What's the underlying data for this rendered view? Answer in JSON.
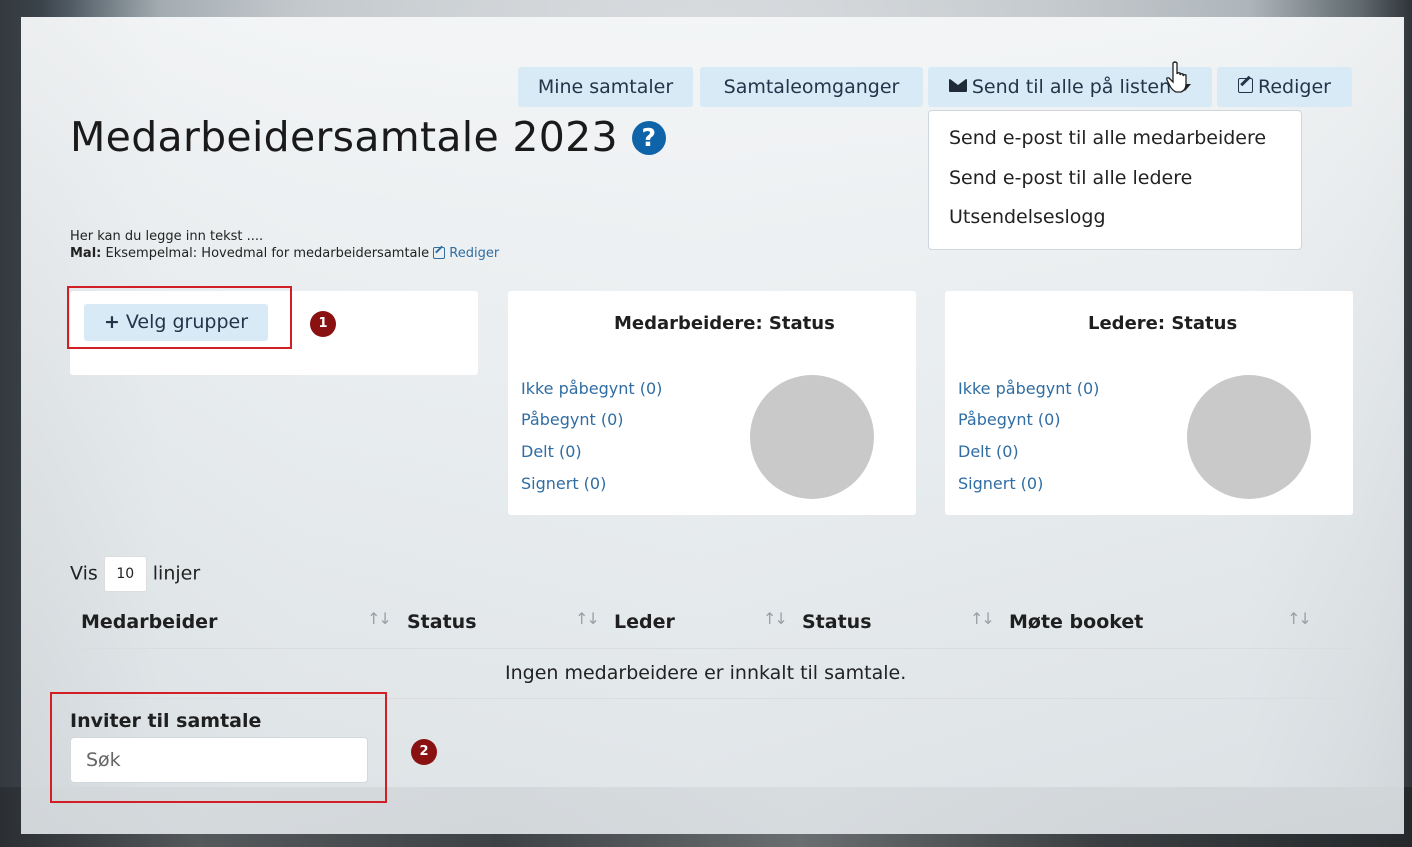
{
  "toolbar": {
    "mine_samtaler": "Mine samtaler",
    "samtaleomganger": "Samtaleomganger",
    "send_til_alle": "Send til alle på listen",
    "rediger": "Rediger"
  },
  "dropdown": {
    "items": [
      "Send e-post til alle medarbeidere",
      "Send e-post til alle ledere",
      "Utsendelseslogg"
    ]
  },
  "page": {
    "title": "Medarbeidersamtale 2023",
    "help": "?",
    "intro_text": "Her kan du legge inn tekst ....",
    "mal_label": "Mal:",
    "mal_value": "Eksempelmal: Hovedmal for medarbeidersamtale",
    "mal_edit": "Rediger"
  },
  "groups": {
    "velg_grupper": "Velg grupper",
    "plus": "+",
    "marker": "1"
  },
  "medarbeidere_status": {
    "title": "Medarbeidere: Status",
    "items": [
      "Ikke påbegynt (0)",
      "Påbegynt (0)",
      "Delt (0)",
      "Signert (0)"
    ]
  },
  "ledere_status": {
    "title": "Ledere: Status",
    "items": [
      "Ikke påbegynt (0)",
      "Påbegynt (0)",
      "Delt (0)",
      "Signert (0)"
    ]
  },
  "table": {
    "vis": "Vis",
    "page_size": "10",
    "linjer": "linjer",
    "columns": [
      "Medarbeider",
      "Status",
      "Leder",
      "Status",
      "Møte booket"
    ],
    "sort_glyph": "↑↓",
    "empty_message": "Ingen medarbeidere er innkalt til samtale."
  },
  "invite": {
    "label": "Inviter til samtale",
    "placeholder": "Søk",
    "marker": "2"
  },
  "colors": {
    "button_bg": "#d7eaf5",
    "link": "#2f6da3",
    "highlight_border": "#d21f26",
    "marker_bg": "#8a1111",
    "help_icon": "#0f63a8",
    "pie_empty": "#c9c9c9"
  }
}
